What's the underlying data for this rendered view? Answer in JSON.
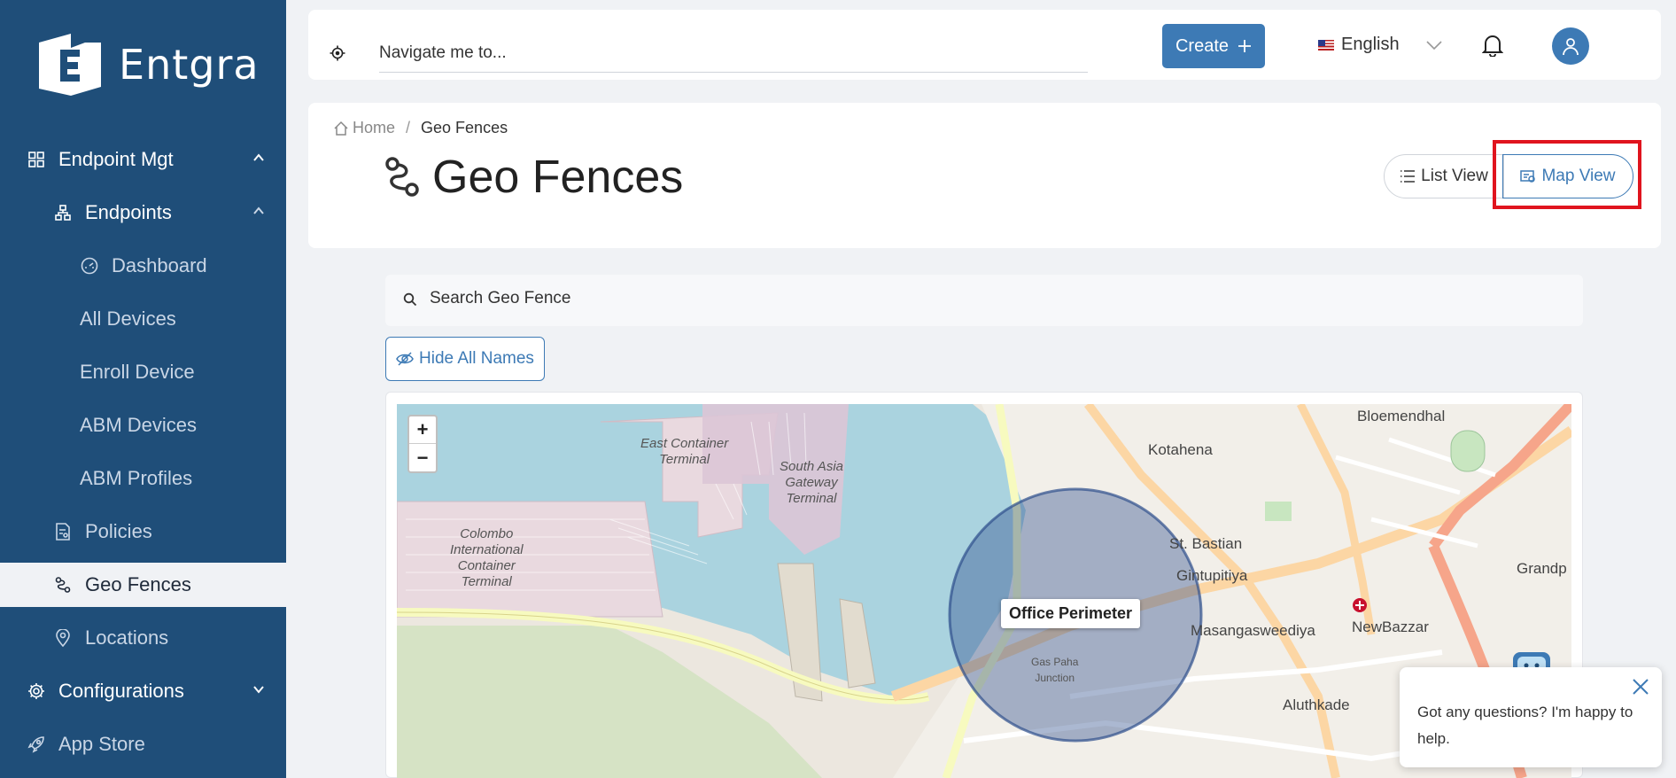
{
  "sidebar": {
    "brand": "Entgra",
    "items": [
      {
        "label": "Endpoint Mgt"
      },
      {
        "label": "Endpoints"
      },
      {
        "label": "Dashboard"
      },
      {
        "label": "All Devices"
      },
      {
        "label": "Enroll Device"
      },
      {
        "label": "ABM Devices"
      },
      {
        "label": "ABM Profiles"
      },
      {
        "label": "Policies"
      },
      {
        "label": "Geo Fences"
      },
      {
        "label": "Locations"
      },
      {
        "label": "Configurations"
      },
      {
        "label": "App Store"
      }
    ]
  },
  "topbar": {
    "navigate_placeholder": "Navigate me to...",
    "create_label": "Create",
    "language": "English"
  },
  "breadcrumb": {
    "home": "Home",
    "current": "Geo Fences"
  },
  "page": {
    "title": "Geo Fences"
  },
  "views": {
    "list_label": "List View",
    "map_label": "Map View"
  },
  "search": {
    "placeholder": "Search Geo Fence"
  },
  "hide_names_label": "Hide All Names",
  "map": {
    "zoom_in": "+",
    "zoom_out": "−",
    "fence_name": "Office Perimeter",
    "labels": {
      "east_container": "East Container\nTerminal",
      "south_asia": "South Asia\nGateway\nTerminal",
      "colombo": "Colombo\nInternational\nContainer\nTerminal",
      "kotahena": "Kotahena",
      "bloemendhal": "Bloemendhal",
      "st_bastian": "St. Bastian",
      "gintupitiya": "Gintupitiya",
      "masangasweediya": "Masangasweediya",
      "newbazzar": "NewBazzar",
      "aluthkade": "Aluthkade",
      "grandp": "Grandp",
      "gas_paha": "Gas Paha\nJunction"
    }
  },
  "chat": {
    "message": "Got any questions? I'm happy to help."
  },
  "colors": {
    "sidebar": "#1f4e79",
    "accent": "#3d7ab5",
    "highlight": "#e0141e"
  }
}
